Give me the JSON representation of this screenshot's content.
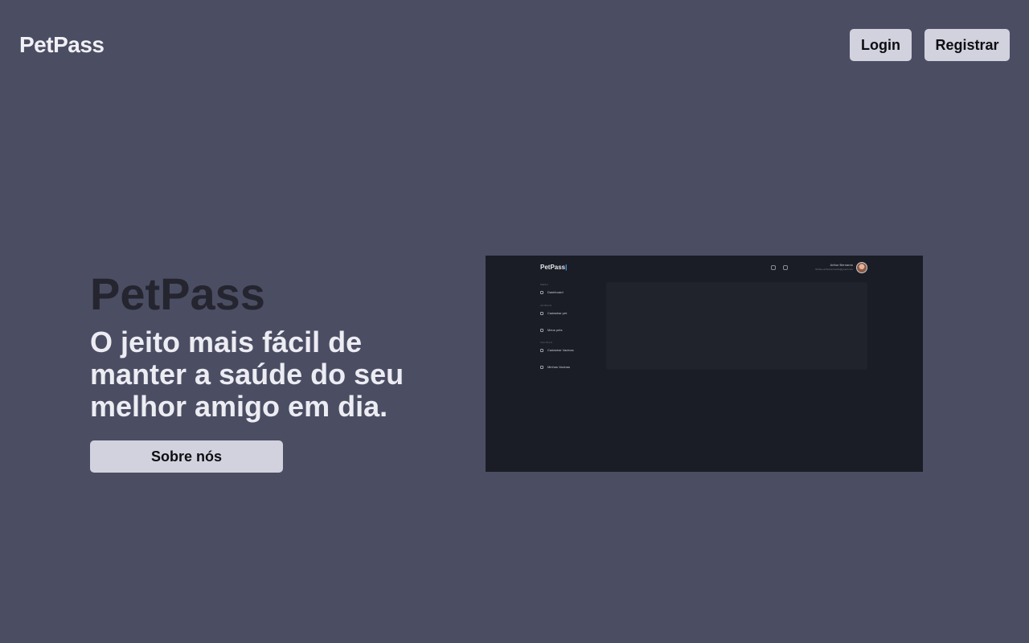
{
  "header": {
    "logo": "PetPass",
    "login_label": "Login",
    "register_label": "Registrar"
  },
  "hero": {
    "title": "PetPass",
    "subtitle": "O jeito mais fácil de manter a saúde do seu melhor amigo em dia.",
    "about_label": "Sobre nós"
  },
  "preview": {
    "logo": "PetPass",
    "user_name": "Arthur Bernardo",
    "user_email": "thiribes.arthurbernardo@gmail.com",
    "sections": [
      "MENU",
      "ANIMAIS",
      "VACINAS"
    ],
    "items": [
      "Dashboard",
      "Cadastrar pet",
      "Meus pets",
      "Cadastrar Vacinas",
      "Minhas Vacinas"
    ]
  },
  "colors": {
    "background": "#4b4d63",
    "button": "#d2d2de",
    "hero_title": "#24252f",
    "hero_subtitle": "#ececf3",
    "preview_bg": "#1a1d25"
  }
}
